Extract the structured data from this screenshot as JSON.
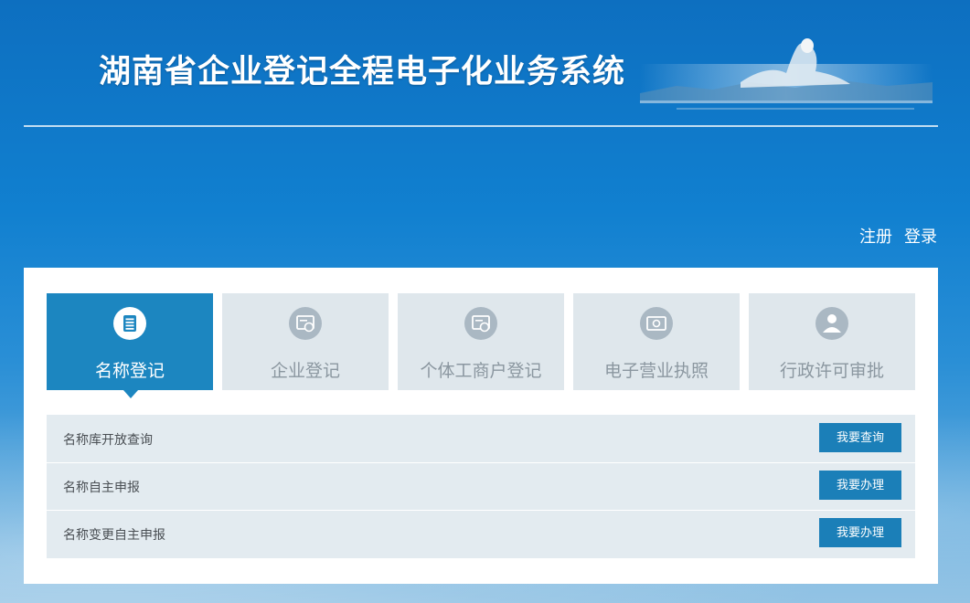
{
  "header": {
    "title": "湖南省企业登记全程电子化业务系统"
  },
  "auth": {
    "register": "注册",
    "login": "登录"
  },
  "tabs": [
    {
      "label": "名称登记",
      "icon": "document-list-icon",
      "active": true
    },
    {
      "label": "企业登记",
      "icon": "certificate-icon",
      "active": false
    },
    {
      "label": "个体工商户登记",
      "icon": "certificate-icon",
      "active": false
    },
    {
      "label": "电子营业执照",
      "icon": "license-icon",
      "active": false
    },
    {
      "label": "行政许可审批",
      "icon": "person-icon",
      "active": false
    }
  ],
  "services": [
    {
      "label": "名称库开放查询",
      "button": "我要查询"
    },
    {
      "label": "名称自主申报",
      "button": "我要办理"
    },
    {
      "label": "名称变更自主申报",
      "button": "我要办理"
    }
  ],
  "colors": {
    "accent": "#1c86c0",
    "button": "#1b7fb8",
    "tab_inactive": "#dfe7ec",
    "list_bg": "#e3ebf0"
  }
}
